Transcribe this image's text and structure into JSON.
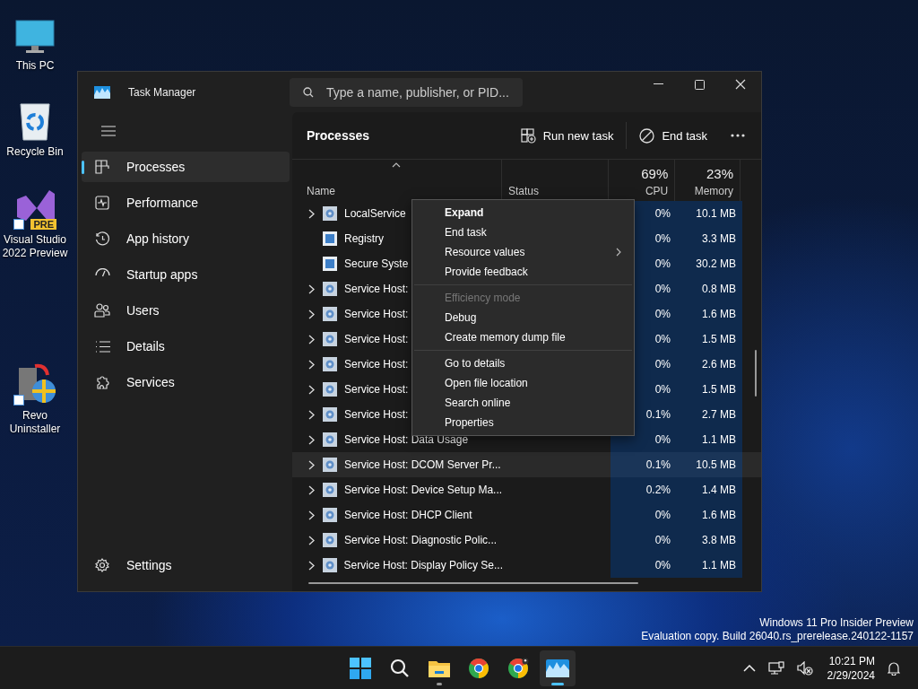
{
  "desktop_icons": [
    {
      "label": "This PC",
      "kind": "monitor"
    },
    {
      "label": "Recycle Bin",
      "kind": "recycle"
    },
    {
      "label": "Visual Studio 2022 Preview",
      "kind": "vs",
      "badge": "PRE",
      "shortcut": true
    },
    {
      "label": "Revo Uninstaller",
      "kind": "revo",
      "shortcut": true
    }
  ],
  "window": {
    "title": "Task Manager",
    "search": {
      "placeholder": "Type a name, publisher, or PID..."
    },
    "nav": [
      {
        "label": "Processes",
        "kind": "processes",
        "selected": true
      },
      {
        "label": "Performance",
        "kind": "performance",
        "selected": false
      },
      {
        "label": "App history",
        "kind": "history",
        "selected": false
      },
      {
        "label": "Startup apps",
        "kind": "startup",
        "selected": false
      },
      {
        "label": "Users",
        "kind": "users",
        "selected": false
      },
      {
        "label": "Details",
        "kind": "details",
        "selected": false
      },
      {
        "label": "Services",
        "kind": "services",
        "selected": false
      }
    ],
    "settings": "Settings",
    "page_title": "Processes",
    "toolbar": [
      {
        "label": "Run new task",
        "kind": "run"
      },
      {
        "label": "End task",
        "kind": "end"
      }
    ]
  },
  "table": {
    "columns": [
      {
        "label": "Name",
        "sorted": true
      },
      {
        "label": "Status",
        "sorted": false
      },
      {
        "label": "CPU",
        "usage": "69%",
        "sorted": false
      },
      {
        "label": "Memory",
        "usage": "23%",
        "sorted": false
      }
    ],
    "rows": [
      {
        "name": "LocalService",
        "kind": "service",
        "expandable": true,
        "cpu": "0%",
        "memory": "10.1 MB",
        "selected": false
      },
      {
        "name": "Registry",
        "kind": "app",
        "expandable": false,
        "cpu": "0%",
        "memory": "3.3 MB",
        "selected": false
      },
      {
        "name": "Secure Syste",
        "kind": "app",
        "expandable": false,
        "cpu": "0%",
        "memory": "30.2 MB",
        "selected": false
      },
      {
        "name": "Service Host:",
        "kind": "service",
        "expandable": true,
        "cpu": "0%",
        "memory": "0.8 MB",
        "selected": false
      },
      {
        "name": "Service Host:",
        "kind": "service",
        "expandable": true,
        "cpu": "0%",
        "memory": "1.6 MB",
        "selected": false
      },
      {
        "name": "Service Host:",
        "kind": "service",
        "expandable": true,
        "cpu": "0%",
        "memory": "1.5 MB",
        "selected": false
      },
      {
        "name": "Service Host:",
        "kind": "service",
        "expandable": true,
        "cpu": "0%",
        "memory": "2.6 MB",
        "selected": false
      },
      {
        "name": "Service Host:",
        "kind": "service",
        "expandable": true,
        "cpu": "0%",
        "memory": "1.5 MB",
        "selected": false
      },
      {
        "name": "Service Host:",
        "kind": "service",
        "expandable": true,
        "cpu": "0.1%",
        "memory": "2.7 MB",
        "selected": false
      },
      {
        "name": "Service Host: Data Usage",
        "kind": "service",
        "expandable": true,
        "cpu": "0%",
        "memory": "1.1 MB",
        "selected": false
      },
      {
        "name": "Service Host: DCOM Server Pr...",
        "kind": "service",
        "expandable": true,
        "cpu": "0.1%",
        "memory": "10.5 MB",
        "selected": true
      },
      {
        "name": "Service Host: Device Setup Ma...",
        "kind": "service",
        "expandable": true,
        "cpu": "0.2%",
        "memory": "1.4 MB",
        "selected": false
      },
      {
        "name": "Service Host: DHCP Client",
        "kind": "service",
        "expandable": true,
        "cpu": "0%",
        "memory": "1.6 MB",
        "selected": false
      },
      {
        "name": "Service Host: Diagnostic Polic...",
        "kind": "service",
        "expandable": true,
        "cpu": "0%",
        "memory": "3.8 MB",
        "selected": false
      },
      {
        "name": "Service Host: Display Policy Se...",
        "kind": "service",
        "expandable": true,
        "cpu": "0%",
        "memory": "1.1 MB",
        "selected": false
      }
    ]
  },
  "context_menu": [
    {
      "kind": "item",
      "label": "Expand",
      "default": true,
      "disabled": false,
      "submenu": false
    },
    {
      "kind": "item",
      "label": "End task",
      "default": false,
      "disabled": false,
      "submenu": false
    },
    {
      "kind": "item",
      "label": "Resource values",
      "default": false,
      "disabled": false,
      "submenu": true
    },
    {
      "kind": "item",
      "label": "Provide feedback",
      "default": false,
      "disabled": false,
      "submenu": false
    },
    {
      "kind": "separator"
    },
    {
      "kind": "item",
      "label": "Efficiency mode",
      "default": false,
      "disabled": true,
      "submenu": false
    },
    {
      "kind": "item",
      "label": "Debug",
      "default": false,
      "disabled": false,
      "submenu": false
    },
    {
      "kind": "item",
      "label": "Create memory dump file",
      "default": false,
      "disabled": false,
      "submenu": false
    },
    {
      "kind": "separator"
    },
    {
      "kind": "item",
      "label": "Go to details",
      "default": false,
      "disabled": false,
      "submenu": false
    },
    {
      "kind": "item",
      "label": "Open file location",
      "default": false,
      "disabled": false,
      "submenu": false
    },
    {
      "kind": "item",
      "label": "Search online",
      "default": false,
      "disabled": false,
      "submenu": false
    },
    {
      "kind": "item",
      "label": "Properties",
      "default": false,
      "disabled": false,
      "submenu": false
    }
  ],
  "watermark": [
    "Windows 11 Pro Insider Preview",
    "Evaluation copy. Build 26040.rs_prerelease.240122-1157"
  ],
  "taskbar": {
    "apps": [
      {
        "kind": "start",
        "running": false,
        "active": false
      },
      {
        "kind": "search",
        "running": false,
        "active": false
      },
      {
        "kind": "folder",
        "running": true,
        "active": false
      },
      {
        "kind": "browser",
        "running": false,
        "active": false
      },
      {
        "kind": "browser-profile",
        "running": false,
        "active": false
      },
      {
        "kind": "taskmanager",
        "running": true,
        "active": true
      }
    ],
    "time": "10:21 PM",
    "date": "2/29/2024"
  }
}
